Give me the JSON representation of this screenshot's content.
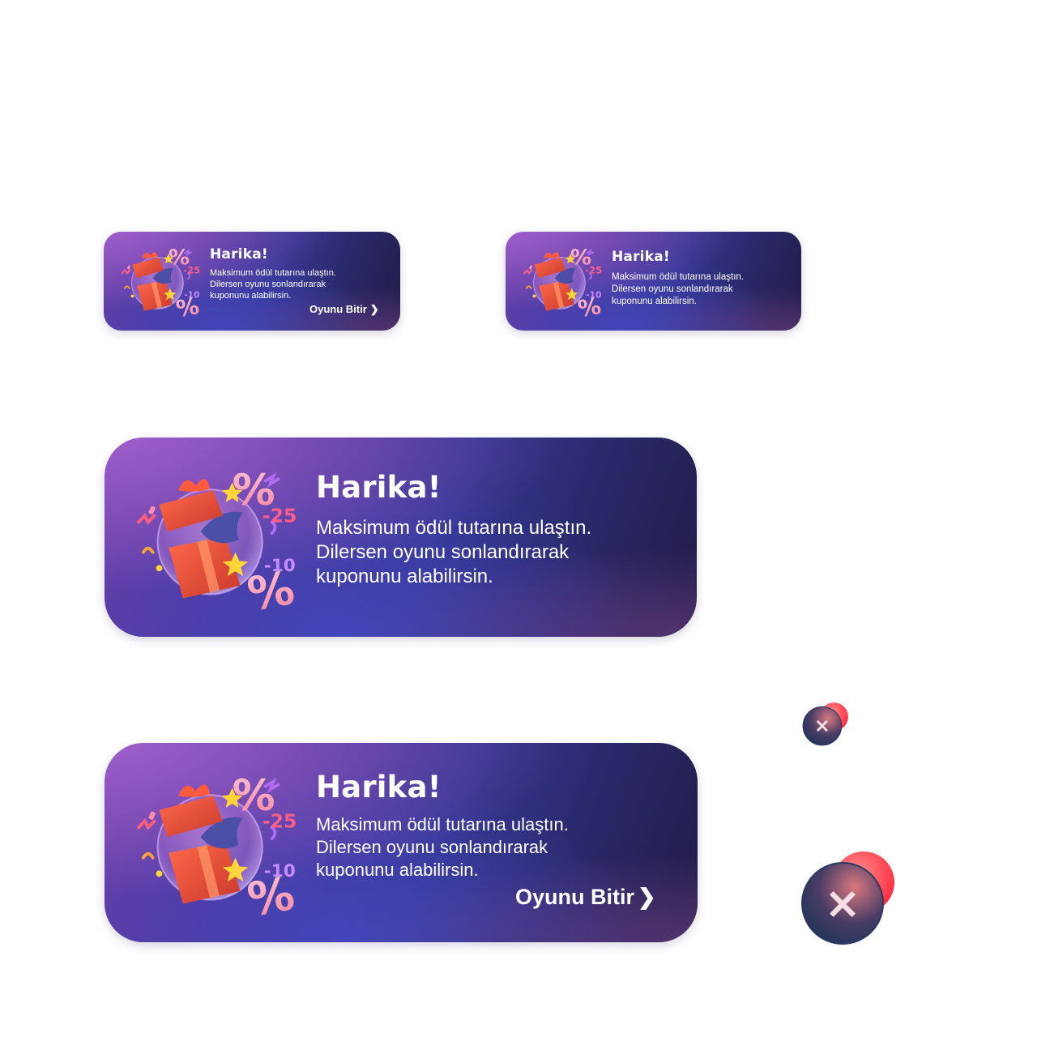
{
  "banners": [
    {
      "title": "Harika!",
      "message_lines": [
        "Maksimum ödül tutarına ulaştın.",
        "Dilersen oyunu sonlandırarak",
        "kuponunu alabilirsin."
      ],
      "cta_label": "Oyunu Bitir",
      "chevron": "❯"
    },
    {
      "title": "Harika!",
      "message_lines": [
        "Maksimum ödül tutarına ulaştın.",
        "Dilersen oyunu sonlandırarak",
        "kuponunu alabilirsin."
      ]
    },
    {
      "title": "Harika!",
      "message_lines": [
        "Maksimum ödül tutarına ulaştın.",
        "Dilersen oyunu sonlandırarak",
        "kuponunu alabilirsin."
      ]
    },
    {
      "title": "Harika!",
      "message_lines": [
        "Maksimum ödül tutarına ulaştın.",
        "Dilersen oyunu sonlandırarak",
        "kuponunu alabilirsin."
      ],
      "cta_label": "Oyunu Bitir",
      "chevron": "❯"
    }
  ],
  "illustration": {
    "icon": "gift-box-discount-icon",
    "discount_labels": [
      "-25",
      "-10"
    ],
    "percent_symbol": "%"
  },
  "close_buttons": [
    {
      "icon": "close-icon",
      "symbol": "×"
    },
    {
      "icon": "close-icon",
      "symbol": "×"
    }
  ],
  "colors": {
    "card_gradient": [
      "#6a3fa8",
      "#34358f",
      "#211b45"
    ],
    "gift_red": "#e8503a",
    "discount_pink": "#f3a0b6",
    "close_red": "#ff3b4a",
    "close_navy": "#23335a"
  }
}
